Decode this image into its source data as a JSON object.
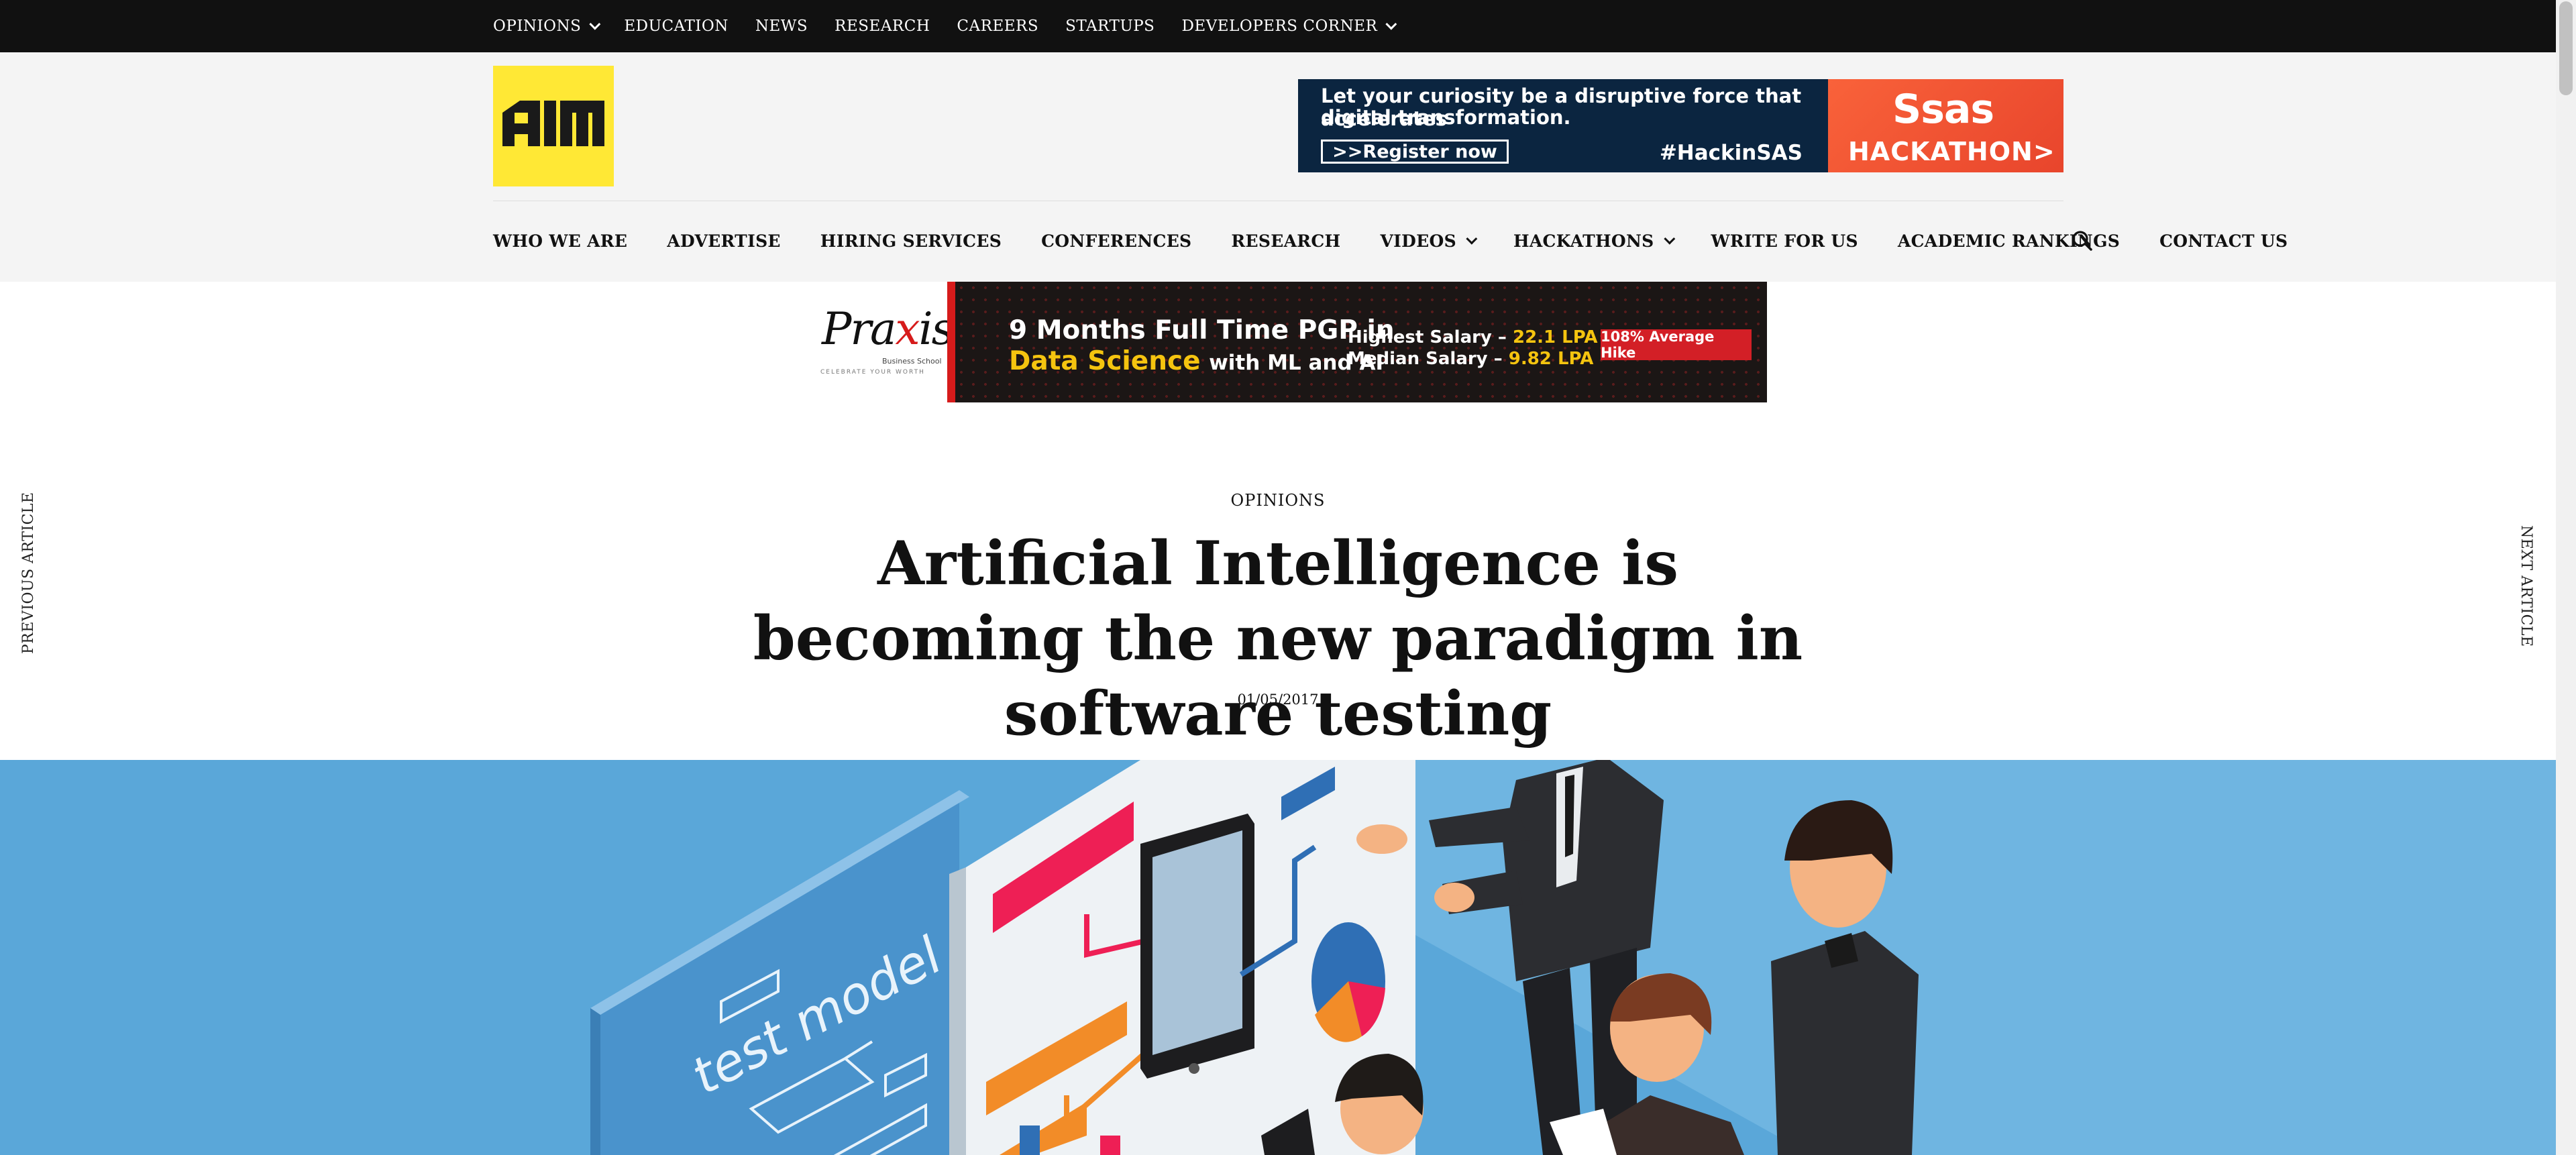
{
  "topnav": {
    "items": [
      {
        "label": "OPINIONS",
        "dropdown": true
      },
      {
        "label": "EDUCATION"
      },
      {
        "label": "NEWS"
      },
      {
        "label": "RESEARCH"
      },
      {
        "label": "CAREERS"
      },
      {
        "label": "STARTUPS"
      },
      {
        "label": "DEVELOPERS CORNER",
        "dropdown": true
      }
    ]
  },
  "logo": {
    "text": "AIM",
    "bg_color": "#ffe835"
  },
  "sas_ad": {
    "line1": "Let your curiosity be a disruptive force that accelerates",
    "line2": "digital transformation.",
    "cta": ">>Register now",
    "hashtag": "#HackinSAS",
    "brand": "Ssas",
    "event": "HACKATHON>"
  },
  "mainnav": {
    "items": [
      {
        "label": "WHO WE ARE"
      },
      {
        "label": "ADVERTISE"
      },
      {
        "label": "HIRING SERVICES"
      },
      {
        "label": "CONFERENCES"
      },
      {
        "label": "RESEARCH"
      },
      {
        "label": "VIDEOS",
        "dropdown": true
      },
      {
        "label": "HACKATHONS",
        "dropdown": true
      },
      {
        "label": "WRITE FOR US"
      },
      {
        "label": "ACADEMIC RANKINGS"
      },
      {
        "label": "CONTACT US"
      }
    ],
    "search_icon": "search-icon"
  },
  "praxis_ad": {
    "logo_pre": "Pra",
    "logo_x": "x",
    "logo_post": "is",
    "logo_sub": "Business School",
    "logo_tagline": "CELEBRATE YOUR WORTH",
    "title": "9 Months Full Time PGP in",
    "subject": "Data Science",
    "subject_suffix": "with ML and AI",
    "salary1_label": "Highest Salary – ",
    "salary1_value": "22.1 LPA",
    "salary2_label": "Median Salary – ",
    "salary2_value": "9.82 LPA",
    "hike": "108% Average Hike"
  },
  "article": {
    "category": "OPINIONS",
    "title": "Artificial Intelligence is becoming the new paradigm in software testing",
    "date": "01/05/2017"
  },
  "side_nav": {
    "previous": "PREVIOUS ARTICLE",
    "next": "NEXT ARTICLE"
  },
  "hero": {
    "board_text": "test model",
    "bg_color": "#5aa7d9"
  },
  "colors": {
    "topbar": "#111111",
    "header_bg": "#f4f4f4",
    "accent_red": "#d61b1b"
  }
}
